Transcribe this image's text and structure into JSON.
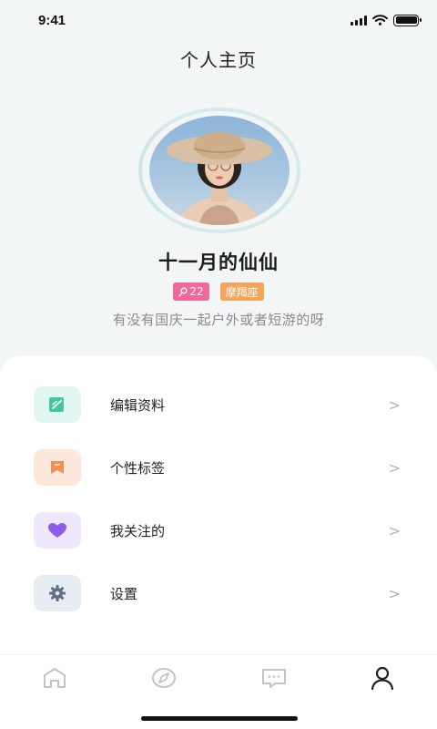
{
  "status_bar": {
    "time": "9:41"
  },
  "page": {
    "title": "个人主页"
  },
  "profile": {
    "name": "十一月的仙仙",
    "age_tag": "22",
    "zodiac_tag": "摩羯座",
    "bio": "有没有国庆一起户外或者短游的呀"
  },
  "menu": {
    "items": [
      {
        "label": "编辑资料",
        "icon": "edit-icon",
        "icon_color": "#44c4a1",
        "bg_color": "#e2f6f1"
      },
      {
        "label": "个性标签",
        "icon": "bookmark-icon",
        "icon_color": "#f19052",
        "bg_color": "#fde9dc"
      },
      {
        "label": "我关注的",
        "icon": "heart-icon",
        "icon_color": "#8e5bea",
        "bg_color": "#efe8fd"
      },
      {
        "label": "设置",
        "icon": "gear-icon",
        "icon_color": "#5f6f86",
        "bg_color": "#e8edf4"
      }
    ],
    "chevron": ">"
  },
  "tab_bar": {
    "tabs": [
      {
        "name": "home-icon",
        "active": false
      },
      {
        "name": "compass-icon",
        "active": false
      },
      {
        "name": "message-icon",
        "active": false
      },
      {
        "name": "profile-icon",
        "active": true
      }
    ]
  },
  "colors": {
    "age_tag": "#f0699a",
    "zodiac_tag": "#f5a55a",
    "ring": "#d6ebe8"
  }
}
